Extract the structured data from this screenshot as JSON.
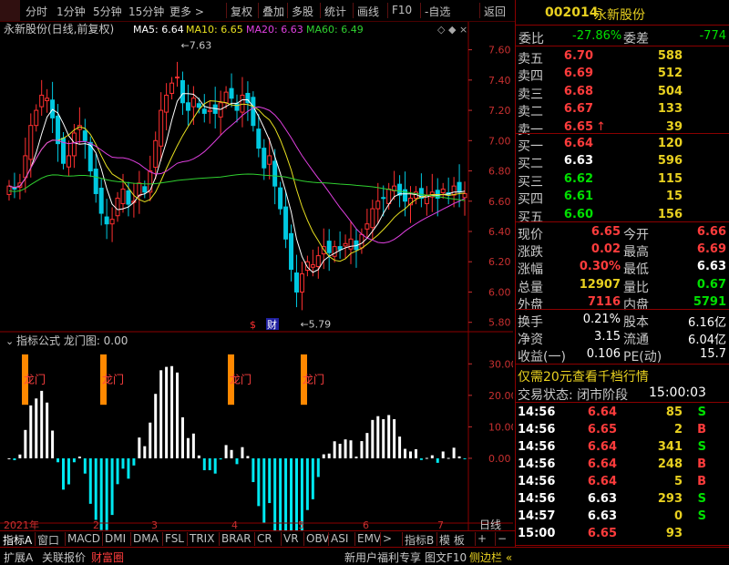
{
  "topbar": {
    "items": [
      "分时",
      "1分钟",
      "5分钟",
      "15分钟",
      "更多 >",
      "复权",
      "叠加",
      "多股",
      "统计",
      "画线",
      "F10",
      "-自选",
      "返回"
    ]
  },
  "chart": {
    "stock_title": "永新股份(日线,前复权)",
    "ma_labels": [
      {
        "text": "MA5: 6.64",
        "color": "#ffffff"
      },
      {
        "text": "MA10: 6.65",
        "color": "#e8e020"
      },
      {
        "text": "MA20: 6.63",
        "color": "#e040e0"
      },
      {
        "text": "MA60: 6.49",
        "color": "#30d030"
      }
    ],
    "y_ticks": [
      "7.60",
      "7.40",
      "7.20",
      "7.00",
      "6.80",
      "6.60",
      "6.40",
      "6.20",
      "6.00",
      "5.80"
    ],
    "high_label": "7.63",
    "low_label": "5.79",
    "markers": [
      "$",
      "财"
    ],
    "indicator_title": "指标公式 龙门图: 0.00",
    "indicator_y_ticks": [
      "30.00",
      "20.00",
      "10.00",
      "0.00"
    ],
    "dragon_labels": [
      "龙门",
      "龙门",
      "龙门",
      "龙门"
    ],
    "x_labels": [
      "2021年",
      "2",
      "3",
      "4",
      "5",
      "6",
      "7"
    ],
    "x_right_label": "日线",
    "colors": {
      "up": "#ff3030",
      "down": "#00c8e0",
      "ma5": "#ffffff",
      "ma10": "#e8e020",
      "ma20": "#e040e0",
      "ma60": "#30d030",
      "dragon": "#ff8800"
    }
  },
  "chart_data": {
    "type": "bar",
    "title": "永新股份(日线,前复权)",
    "candles_close": [
      6.7,
      6.68,
      6.72,
      6.9,
      7.1,
      7.2,
      7.3,
      7.28,
      7.15,
      6.98,
      6.85,
      6.9,
      7.05,
      7.1,
      7.0,
      6.8,
      6.65,
      6.52,
      6.45,
      6.48,
      6.62,
      6.68,
      6.58,
      6.6,
      6.72,
      6.66,
      6.8,
      7.0,
      7.2,
      7.3,
      7.38,
      7.42,
      7.25,
      7.2,
      7.28,
      7.22,
      7.18,
      7.2,
      7.18,
      7.25,
      7.32,
      7.28,
      7.2,
      7.3,
      7.25,
      7.1,
      6.95,
      6.82,
      6.9,
      6.7,
      6.55,
      6.35,
      6.15,
      6.0,
      6.12,
      6.2,
      6.18,
      6.24,
      6.3,
      6.26,
      6.3,
      6.28,
      6.32,
      6.35,
      6.28,
      6.38,
      6.45,
      6.55,
      6.6,
      6.62,
      6.68,
      6.7,
      6.64,
      6.6,
      6.62,
      6.66,
      6.62,
      6.64,
      6.66,
      6.62,
      6.68,
      6.64,
      6.7,
      6.66,
      6.65
    ],
    "ma60_label": "6.49",
    "high": 7.63,
    "low": 5.79,
    "ylim": [
      5.75,
      7.7
    ],
    "indicator": {
      "name": "龙门图",
      "value": 0.0,
      "ylim": [
        -20,
        35
      ]
    }
  },
  "tabs": {
    "items": [
      "指标A",
      "窗口",
      "MACD",
      "DMI",
      "DMA",
      "FSL",
      "TRIX",
      "BRAR",
      "CR",
      "VR",
      "OBV",
      "ASI",
      "EMV",
      ">",
      "指标B",
      "模 板",
      "+",
      "−"
    ]
  },
  "quote": {
    "code": "002014",
    "name": "永新股份",
    "weibi_label": "委比",
    "weibi": "-27.86%",
    "weicha_label": "委差",
    "weicha": "-774",
    "asks": [
      {
        "label": "卖五",
        "price": "6.70",
        "vol": "588",
        "pc": "red"
      },
      {
        "label": "卖四",
        "price": "6.69",
        "vol": "512",
        "pc": "red"
      },
      {
        "label": "卖三",
        "price": "6.68",
        "vol": "504",
        "pc": "red"
      },
      {
        "label": "卖二",
        "price": "6.67",
        "vol": "133",
        "pc": "red"
      },
      {
        "label": "卖一",
        "price": "6.65",
        "vol": "39",
        "pc": "red",
        "arrow": "↑"
      }
    ],
    "bids": [
      {
        "label": "买一",
        "price": "6.64",
        "vol": "120",
        "pc": "red"
      },
      {
        "label": "买二",
        "price": "6.63",
        "vol": "596",
        "pc": "wht"
      },
      {
        "label": "买三",
        "price": "6.62",
        "vol": "115",
        "pc": "grn"
      },
      {
        "label": "买四",
        "price": "6.61",
        "vol": "15",
        "pc": "grn"
      },
      {
        "label": "买五",
        "price": "6.60",
        "vol": "156",
        "pc": "grn"
      }
    ],
    "stats": [
      {
        "l1": "现价",
        "v1": "6.65",
        "c1": "red",
        "l2": "今开",
        "v2": "6.66",
        "c2": "red"
      },
      {
        "l1": "涨跌",
        "v1": "0.02",
        "c1": "red",
        "l2": "最高",
        "v2": "6.69",
        "c2": "red"
      },
      {
        "l1": "涨幅",
        "v1": "0.30%",
        "c1": "red",
        "l2": "最低",
        "v2": "6.63",
        "c2": "wht"
      },
      {
        "l1": "总量",
        "v1": "12907",
        "c1": "yel",
        "l2": "量比",
        "v2": "0.67",
        "c2": "grn"
      },
      {
        "l1": "外盘",
        "v1": "7116",
        "c1": "red",
        "l2": "内盘",
        "v2": "5791",
        "c2": "grn"
      }
    ],
    "fin": [
      {
        "l1": "换手",
        "v1": "0.21%",
        "l2": "股本",
        "v2": "6.16亿"
      },
      {
        "l1": "净资",
        "v1": "3.15",
        "l2": "流通",
        "v2": "6.04亿"
      },
      {
        "l1": "收益(一)",
        "v1": "0.106",
        "l2": "PE(动)",
        "v2": "15.7"
      }
    ],
    "promo": "仅需20元查看千档行情",
    "trade_status": "交易状态: 闭市阶段",
    "trade_time": "15:00:03",
    "ticks": [
      {
        "t": "14:56",
        "p": "6.64",
        "pc": "red",
        "v": "85",
        "d": "S"
      },
      {
        "t": "14:56",
        "p": "6.65",
        "pc": "red",
        "v": "2",
        "d": "B"
      },
      {
        "t": "14:56",
        "p": "6.64",
        "pc": "red",
        "v": "341",
        "d": "S"
      },
      {
        "t": "14:56",
        "p": "6.64",
        "pc": "red",
        "v": "248",
        "d": "B"
      },
      {
        "t": "14:56",
        "p": "6.64",
        "pc": "red",
        "v": "5",
        "d": "B"
      },
      {
        "t": "14:56",
        "p": "6.63",
        "pc": "wht",
        "v": "293",
        "d": "S"
      },
      {
        "t": "14:57",
        "p": "6.63",
        "pc": "wht",
        "v": "0",
        "d": "S"
      },
      {
        "t": "15:00",
        "p": "6.65",
        "pc": "red",
        "v": "93",
        "d": ""
      }
    ],
    "right_tabs": [
      "笔",
      "价",
      "细",
      "势",
      "联",
      "值",
      "主",
      "筹"
    ]
  },
  "bottom": {
    "left": [
      "扩展A",
      "关联报价",
      "财富圈"
    ],
    "right": [
      "新用户福利专享",
      "图文F10",
      "侧边栏 «"
    ]
  }
}
